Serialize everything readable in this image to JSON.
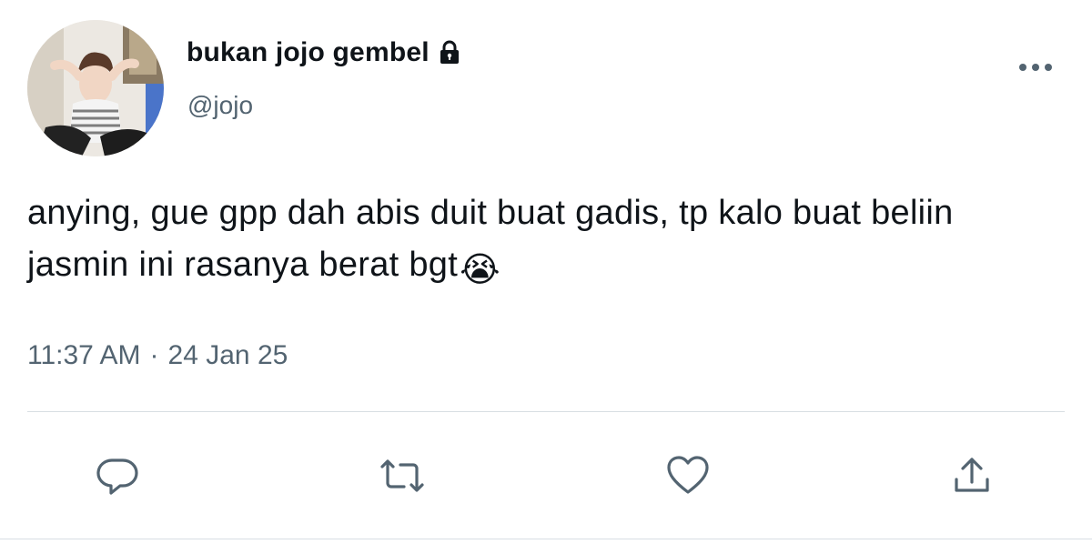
{
  "user": {
    "display_name": "bukan jojo gembel",
    "handle": "@jojo",
    "protected_icon": "lock-icon"
  },
  "tweet": {
    "text": "anying, gue gpp dah abis duit buat gadis, tp kalo buat beliin jasmin ini rasanya berat bgt",
    "emoji": "😭",
    "time": "11:37 AM",
    "separator": "·",
    "date": "24 Jan 25"
  },
  "icons": {
    "more": "more-horizontal-icon",
    "reply": "reply-icon",
    "retweet": "retweet-icon",
    "like": "heart-icon",
    "share": "share-icon"
  },
  "colors": {
    "text": "#0f1419",
    "secondary": "#536471",
    "divider": "#d8dee3"
  }
}
